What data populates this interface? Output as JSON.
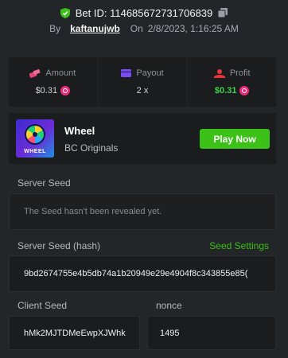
{
  "header": {
    "bet_id_label": "Bet ID:",
    "bet_id": "114685672731706839",
    "by_label": "By",
    "username": "kaftanujwb",
    "on_label": "On",
    "datetime": "2/8/2023, 1:16:25 AM"
  },
  "stats": [
    {
      "label": "Amount",
      "value": "$0.31"
    },
    {
      "label": "Payout",
      "value": "2 x"
    },
    {
      "label": "Profit",
      "value": "$0.31"
    }
  ],
  "game": {
    "title": "Wheel",
    "provider": "BC Originals",
    "thumb_label": "WHEEL",
    "play_label": "Play Now"
  },
  "server_seed": {
    "label": "Server Seed",
    "value": "The Seed hasn't been revealed yet."
  },
  "server_seed_hash": {
    "label": "Server Seed (hash)",
    "settings_label": "Seed Settings",
    "value": "9bd2674755e4b5db74a1b20949e29e4904f8c343855e85("
  },
  "client_seed": {
    "label": "Client Seed",
    "value": "hMk2MJTDMeEwpXJWhk"
  },
  "nonce": {
    "label": "nonce",
    "value": "1495"
  },
  "colors": {
    "background": "#232628",
    "panel": "#1a1c1e",
    "accent_green": "#3bc117",
    "coin_pink": "#ee2b7a"
  }
}
